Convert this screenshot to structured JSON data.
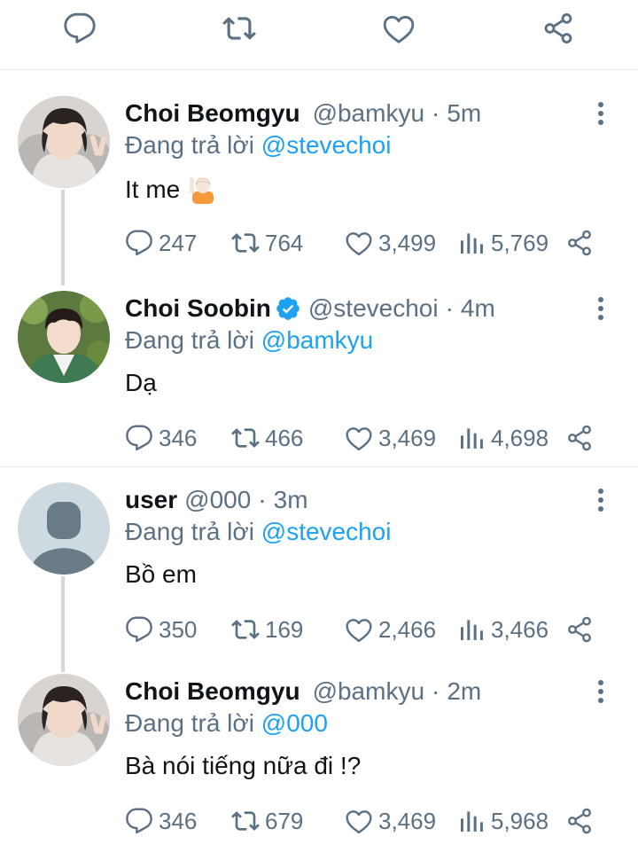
{
  "top_actions": [
    "reply-icon",
    "retweet-icon",
    "like-icon",
    "share-icon"
  ],
  "colors": {
    "text": "#0f1419",
    "muted": "#5b7083",
    "link": "#1da1f2",
    "divider": "#e1e6ea",
    "thread_line": "#cfd9de",
    "verified": "#1da1f2"
  },
  "tweets": [
    {
      "name": "Choi Beomgyu",
      "handle": "@bamkyu",
      "time": "5m",
      "reply_prefix": "Đang trả lời ",
      "reply_mention": "@stevechoi",
      "text": "It me",
      "emoji": "person-raising-hand",
      "stats": {
        "replies": "247",
        "retweets": "764",
        "likes": "3,499",
        "views": "5,769"
      }
    },
    {
      "name": "Choi Soobin",
      "verified": true,
      "handle": "@stevechoi",
      "time": "4m",
      "reply_prefix": "Đang trả lời ",
      "reply_mention": "@bamkyu",
      "text": "Dạ",
      "stats": {
        "replies": "346",
        "retweets": "466",
        "likes": "3,469",
        "views": "4,698"
      }
    },
    {
      "name": "user",
      "handle": "@000",
      "time": "3m",
      "reply_prefix": "Đang trả lời ",
      "reply_mention": "@stevechoi",
      "text": "Bồ em",
      "stats": {
        "replies": "350",
        "retweets": "169",
        "likes": "2,466",
        "views": "3,466"
      }
    },
    {
      "name": "Choi Beomgyu",
      "handle": "@bamkyu",
      "time": "2m",
      "reply_prefix": "Đang trả lời ",
      "reply_mention": "@000",
      "text": "Bà nói tiếng nữa đi !?",
      "stats": {
        "replies": "346",
        "retweets": "679",
        "likes": "3,469",
        "views": "5,968"
      }
    }
  ],
  "separator": "·"
}
